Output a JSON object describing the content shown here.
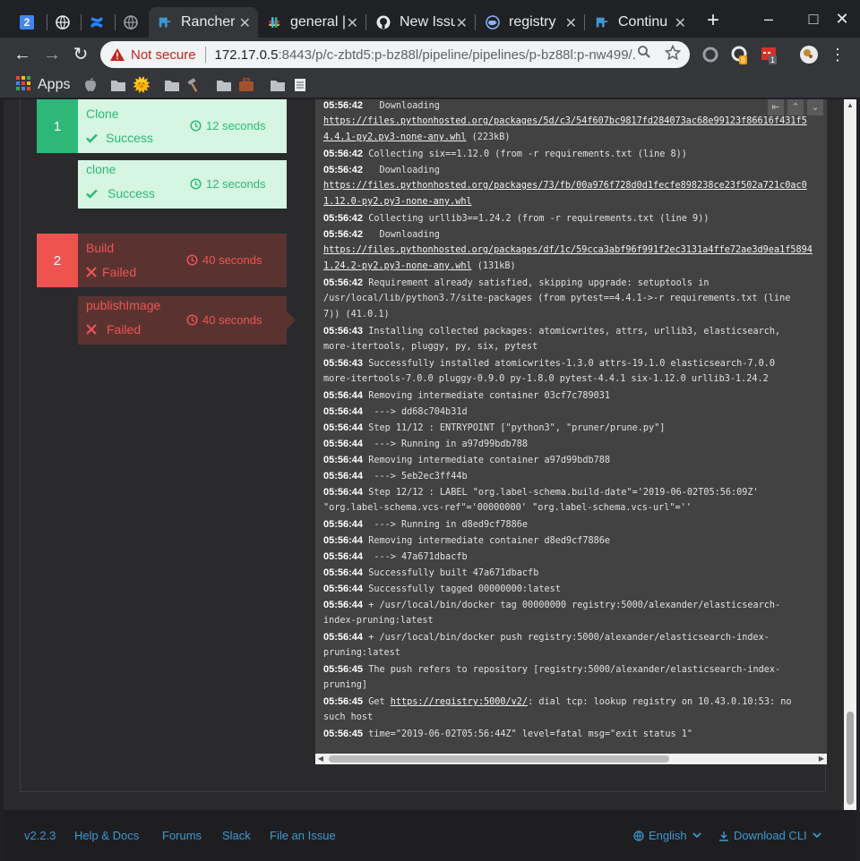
{
  "browser": {
    "tabs": [
      {
        "title": "",
        "favicon": "calendar-2-icon",
        "fav_text": "2"
      },
      {
        "title": "",
        "favicon": "globe-icon"
      },
      {
        "title": "",
        "favicon": "confluence-icon"
      },
      {
        "title": "",
        "favicon": "globe-icon"
      },
      {
        "title": "Rancher",
        "favicon": "rancher-icon",
        "active": true
      },
      {
        "title": "general |",
        "favicon": "slack-icon"
      },
      {
        "title": "New Issu",
        "favicon": "github-icon"
      },
      {
        "title": "registry",
        "favicon": "docker-icon"
      },
      {
        "title": "Continu",
        "favicon": "rancher-icon"
      }
    ],
    "close_glyph": "✕",
    "new_tab_glyph": "+",
    "window_controls": [
      "–",
      "□",
      "✕"
    ],
    "nav": {
      "back": "←",
      "forward": "→",
      "reload": "↻"
    },
    "security_label": "Not secure",
    "url_host": "172.17.0.5",
    "url_rest": ":8443/p/c-zbtd5:p-bz88l/pipeline/pipelines/p-bz88l:p-nw499/...",
    "ext_badges": [
      "8",
      "1"
    ],
    "bookmarks": {
      "apps_label": "Apps",
      "items": [
        "apple-icon",
        "folder-icon",
        "sun-icon",
        "folder-icon",
        "hammer-icon",
        "folder-icon",
        "briefcase-icon",
        "folder-icon",
        "notepad-icon"
      ]
    }
  },
  "colors": {
    "success": "#2db87a",
    "success_bg": "#d6f5e3",
    "failed": "#ef5350",
    "failed_bg": "#5a3331",
    "link": "#3d98d3"
  },
  "stages": [
    {
      "number": "1",
      "name": "Clone",
      "status": "Success",
      "duration": "12 seconds",
      "steps": [
        {
          "name": "clone",
          "status": "Success",
          "duration": "12 seconds"
        }
      ]
    },
    {
      "number": "2",
      "name": "Build",
      "status": "Failed",
      "duration": "40 seconds",
      "steps": [
        {
          "name": "publishImage",
          "status": "Failed",
          "duration": "40 seconds"
        }
      ]
    }
  ],
  "log_lines": [
    {
      "t": "05:56:42",
      "msg": "  Downloading"
    },
    {
      "t": "",
      "link": "https://files.pythonhosted.org/packages/5d/c3/54f607bc9817fd284073ac68e99123f86616f431f5"
    },
    {
      "t": "",
      "link": "4.4.1-py2.py3-none-any.whl",
      "msg": " (223kB)"
    },
    {
      "t": "05:56:42",
      "msg": "Collecting six==1.12.0 (from -r requirements.txt (line 8))"
    },
    {
      "t": "05:56:42",
      "msg": "  Downloading"
    },
    {
      "t": "",
      "link": "https://files.pythonhosted.org/packages/73/fb/00a976f728d0d1fecfe898238ce23f502a721c0ac0"
    },
    {
      "t": "",
      "link": "1.12.0-py2.py3-none-any.whl"
    },
    {
      "t": "05:56:42",
      "msg": "Collecting urllib3==1.24.2 (from -r requirements.txt (line 9))"
    },
    {
      "t": "05:56:42",
      "msg": "  Downloading"
    },
    {
      "t": "",
      "link": "https://files.pythonhosted.org/packages/df/1c/59cca3abf96f991f2ec3131a4ffe72ae3d9ea1f5894"
    },
    {
      "t": "",
      "link": "1.24.2-py2.py3-none-any.whl",
      "msg": " (131kB)"
    },
    {
      "t": "05:56:42",
      "msg": "Requirement already satisfied, skipping upgrade: setuptools in"
    },
    {
      "t": "",
      "msg": "/usr/local/lib/python3.7/site-packages (from pytest==4.4.1->-r requirements.txt (line"
    },
    {
      "t": "",
      "msg": "7)) (41.0.1)"
    },
    {
      "t": "05:56:43",
      "msg": "Installing collected packages: atomicwrites, attrs, urllib3, elasticsearch,"
    },
    {
      "t": "",
      "msg": "more-itertools, pluggy, py, six, pytest"
    },
    {
      "t": "05:56:43",
      "msg": "Successfully installed atomicwrites-1.3.0 attrs-19.1.0 elasticsearch-7.0.0"
    },
    {
      "t": "",
      "msg": "more-itertools-7.0.0 pluggy-0.9.0 py-1.8.0 pytest-4.4.1 six-1.12.0 urllib3-1.24.2"
    },
    {
      "t": "05:56:44",
      "msg": "Removing intermediate container 03cf7c789031"
    },
    {
      "t": "05:56:44",
      "msg": " ---> dd68c704b31d"
    },
    {
      "t": "05:56:44",
      "msg": "Step 11/12 : ENTRYPOINT [\"python3\", \"pruner/prune.py\"]"
    },
    {
      "t": "05:56:44",
      "msg": " ---> Running in a97d99bdb788"
    },
    {
      "t": "05:56:44",
      "msg": "Removing intermediate container a97d99bdb788"
    },
    {
      "t": "05:56:44",
      "msg": " ---> 5eb2ec3ff44b"
    },
    {
      "t": "05:56:44",
      "msg": "Step 12/12 : LABEL \"org.label-schema.build-date\"='2019-06-02T05:56:09Z'"
    },
    {
      "t": "",
      "msg": "\"org.label-schema.vcs-ref\"='00000000' \"org.label-schema.vcs-url\"=''"
    },
    {
      "t": "05:56:44",
      "msg": " ---> Running in d8ed9cf7886e"
    },
    {
      "t": "05:56:44",
      "msg": "Removing intermediate container d8ed9cf7886e"
    },
    {
      "t": "05:56:44",
      "msg": " ---> 47a671dbacfb"
    },
    {
      "t": "05:56:44",
      "msg": "Successfully built 47a671dbacfb"
    },
    {
      "t": "05:56:44",
      "msg": "Successfully tagged 00000000:latest"
    },
    {
      "t": "05:56:44",
      "msg": "+ /usr/local/bin/docker tag 00000000 registry:5000/alexander/elasticsearch-"
    },
    {
      "t": "",
      "msg": "index-pruning:latest"
    },
    {
      "t": "05:56:44",
      "msg": "+ /usr/local/bin/docker push registry:5000/alexander/elasticsearch-index-"
    },
    {
      "t": "",
      "msg": "pruning:latest"
    },
    {
      "t": "05:56:45",
      "msg": "The push refers to repository [registry:5000/alexander/elasticsearch-index-"
    },
    {
      "t": "",
      "msg": "pruning]"
    },
    {
      "t": "05:56:45",
      "msg": "Get ",
      "link": "https://registry:5000/v2/",
      "msg2": ": dial tcp: lookup registry on 10.43.0.10:53: no"
    },
    {
      "t": "",
      "msg": "such host"
    },
    {
      "t": "05:56:45",
      "msg": "time=\"2019-06-02T05:56:44Z\" level=fatal msg=\"exit status 1\""
    }
  ],
  "footer": {
    "version": "v2.2.3",
    "links": [
      "Help & Docs",
      "Forums",
      "Slack",
      "File an Issue"
    ],
    "language": "English",
    "download": "Download CLI"
  }
}
